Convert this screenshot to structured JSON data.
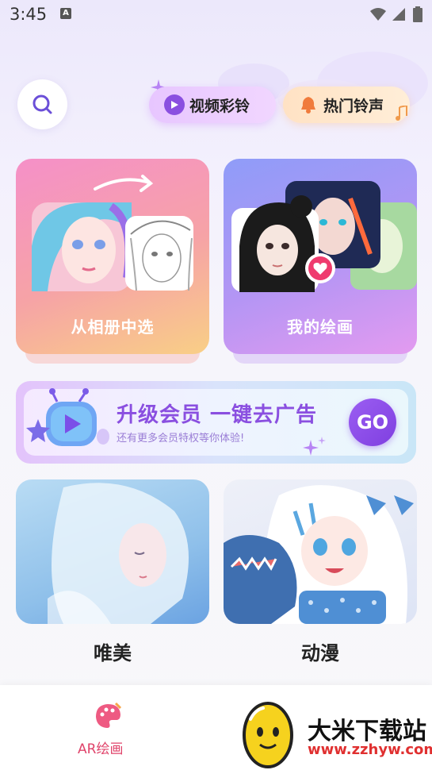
{
  "status_bar": {
    "time": "3:45",
    "notification_badge": "A"
  },
  "top": {
    "video_ringtone": "视频彩铃",
    "hot_ringtone": "热门铃声"
  },
  "cards": {
    "album": "从相册中选",
    "mine": "我的绘画"
  },
  "banner": {
    "title": "升级会员 一键去广告",
    "subtitle": "还有更多会员特权等你体验!",
    "go": "GO"
  },
  "categories": [
    {
      "label": "唯美"
    },
    {
      "label": "动漫"
    }
  ],
  "bottom_nav": {
    "ar_label": "AR绘画"
  },
  "watermark": {
    "name": "大米下载站",
    "url": "www.zzhyw.com"
  },
  "colors": {
    "accent_purple": "#8a4fe0",
    "nav_active": "#e0446b"
  }
}
